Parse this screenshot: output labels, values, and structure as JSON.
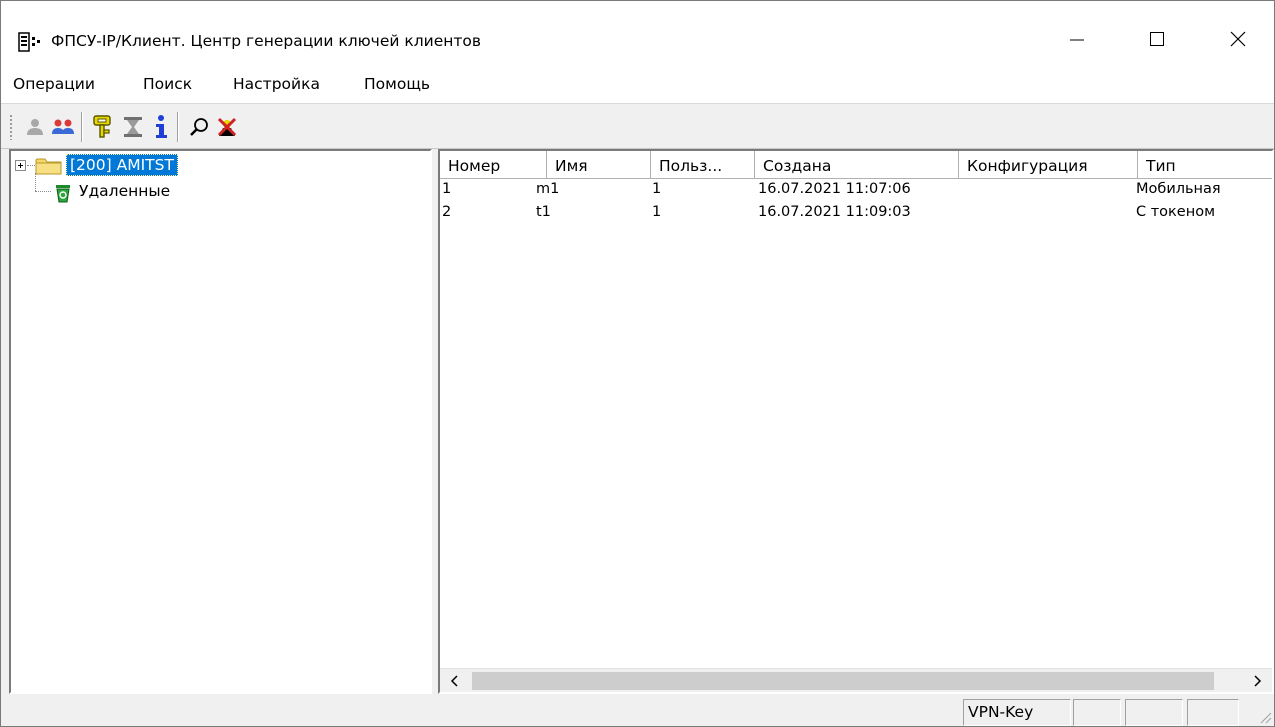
{
  "window": {
    "title": "ФПСУ-IP/Клиент. Центр генерации ключей клиентов",
    "controls": [
      "minimize-icon",
      "maximize-icon",
      "close-icon"
    ]
  },
  "menu": {
    "items": [
      "Операции",
      "Поиск",
      "Настройка",
      "Помощь"
    ]
  },
  "toolbar": {
    "buttons": [
      "user-gray-icon",
      "users-group-icon",
      "key-yellow-icon",
      "hourglass-icon",
      "info-icon",
      "search-icon",
      "delete-icon"
    ]
  },
  "tree": {
    "nodes": [
      {
        "label": "[200] AMITST",
        "icon": "folder-icon",
        "selected": true,
        "expandable": true
      },
      {
        "label": "Удаленные",
        "icon": "trash-icon",
        "selected": false,
        "expandable": false
      }
    ]
  },
  "list": {
    "columns": [
      "Номер",
      "Имя",
      "Польз...",
      "Создана",
      "Конфигурация",
      "Тип"
    ],
    "rows": [
      {
        "number": "1",
        "name": "m1",
        "user": "1",
        "created": "16.07.2021 11:07:06",
        "config": "",
        "type": "Мобильная"
      },
      {
        "number": "2",
        "name": "t1",
        "user": "1",
        "created": "16.07.2021 11:09:03",
        "config": "",
        "type": "С токеном"
      }
    ]
  },
  "statusbar": {
    "panels": [
      "VPN-Key",
      "",
      "",
      ""
    ]
  },
  "colors": {
    "selection": "#0078d7",
    "folder": "#f5d66a",
    "key": "#d4c400",
    "info": "#1f3fd6",
    "delete": "#cc2222"
  }
}
